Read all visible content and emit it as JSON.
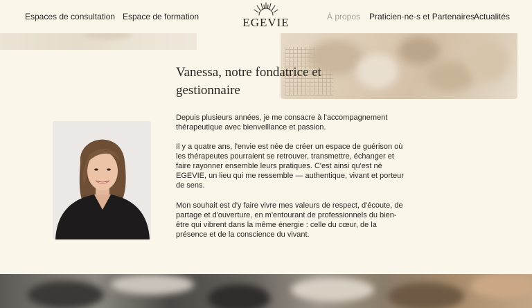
{
  "nav": {
    "left_items": [
      "Espaces de consultation",
      "Espace de formation"
    ],
    "right_items": [
      "À propos",
      "Praticien·ne·s et Partenaires",
      "Actualités"
    ],
    "active_item": "À propos",
    "logo_text": "EGEVIE"
  },
  "about": {
    "title": "Vanessa, notre fondatrice et gestionnaire",
    "paragraphs": [
      "Depuis plusieurs années, je me consacre à l'accompagnement thérapeutique avec bienveillance et passion.",
      "Il y a quatre ans, l'envie est née de créer un espace de guérison où les thérapeutes pourraient se retrouver, transmettre, échanger et faire rayonner ensemble leurs pratiques. C'est ainsi qu'est né EGEVIE, un lieu qui me ressemble — authentique, vivant et porteur de sens.",
      "Mon souhait est d'y faire vivre mes valeurs de respect, d'écoute, de partage et d'ouverture, en m'entourant de professionnels du bien-être qui vibrent dans la même énergie : celle du cœur, de la présence et de la conscience du vivant."
    ]
  },
  "colors": {
    "background": "#faf6ea",
    "text": "#2b2621",
    "nav_active": "#a7a295"
  }
}
